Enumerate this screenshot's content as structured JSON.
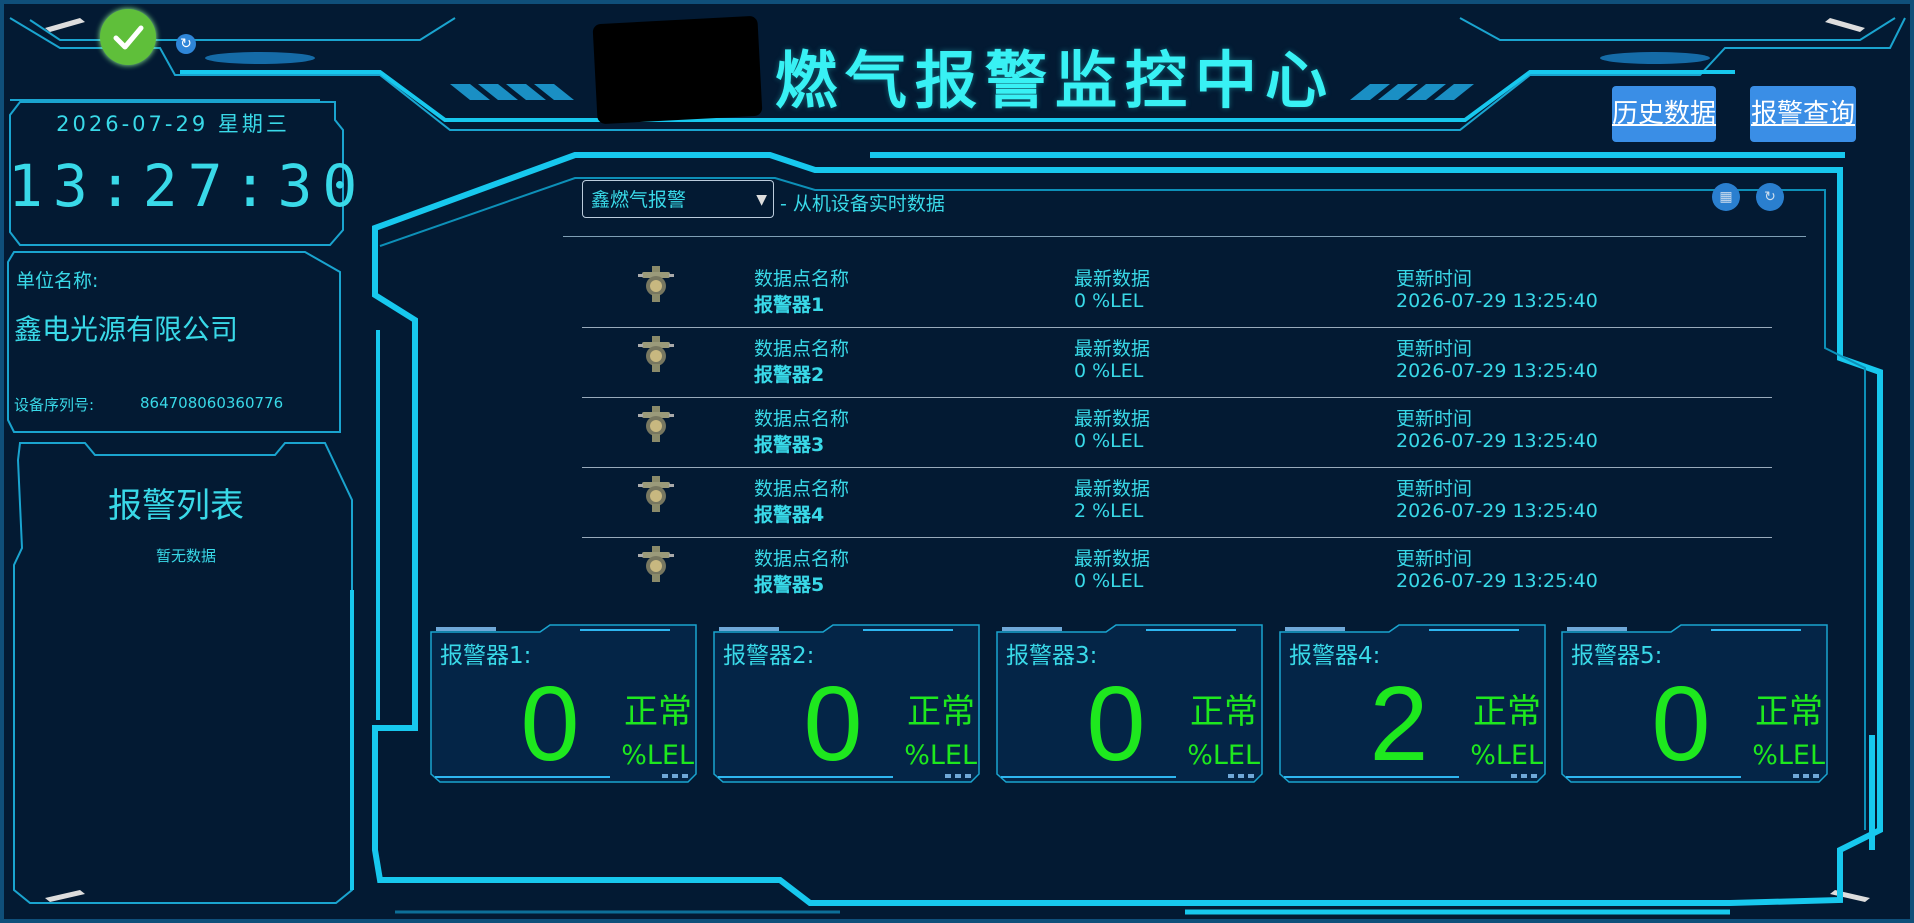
{
  "header": {
    "title": "燃气报警监控中心",
    "history_button": "历史数据",
    "alarm_query_button": "报警查询"
  },
  "clock": {
    "date": "2026-07-29 星期三",
    "time": "13:27:30"
  },
  "unit": {
    "label": "单位名称:",
    "name": "鑫电光源有限公司",
    "serial_label": "设备序列号:",
    "serial_value": "864708060360776"
  },
  "alarm_list": {
    "title": "报警列表",
    "empty_text": "暂无数据"
  },
  "device": {
    "selected": "鑫燃气报警",
    "subtitle": "- 从机设备实时数据"
  },
  "table": {
    "col_name": "数据点名称",
    "col_latest": "最新数据",
    "col_time": "更新时间",
    "rows": [
      {
        "name": "报警器1",
        "value": "0 %LEL",
        "time": "2026-07-29 13:25:40"
      },
      {
        "name": "报警器2",
        "value": "0 %LEL",
        "time": "2026-07-29 13:25:40"
      },
      {
        "name": "报警器3",
        "value": "0 %LEL",
        "time": "2026-07-29 13:25:40"
      },
      {
        "name": "报警器4",
        "value": "2 %LEL",
        "time": "2026-07-29 13:25:40"
      },
      {
        "name": "报警器5",
        "value": "0 %LEL",
        "time": "2026-07-29 13:25:40"
      }
    ]
  },
  "cards": [
    {
      "name": "报警器1:",
      "value": "0",
      "status": "正常",
      "unit": "%LEL"
    },
    {
      "name": "报警器2:",
      "value": "0",
      "status": "正常",
      "unit": "%LEL"
    },
    {
      "name": "报警器3:",
      "value": "0",
      "status": "正常",
      "unit": "%LEL"
    },
    {
      "name": "报警器4:",
      "value": "2",
      "status": "正常",
      "unit": "%LEL"
    },
    {
      "name": "报警器5:",
      "value": "0",
      "status": "正常",
      "unit": "%LEL"
    }
  ],
  "icons": {
    "status": "check-icon",
    "refresh": "refresh-icon",
    "grid": "grid-icon",
    "reload": "reload-icon",
    "sensor": "gas-sensor-icon"
  },
  "colors": {
    "background": "#031a33",
    "frame": "#17c8ee",
    "text": "#39d9e8",
    "ok_green": "#1ee81e",
    "button": "#3a8ee6"
  }
}
